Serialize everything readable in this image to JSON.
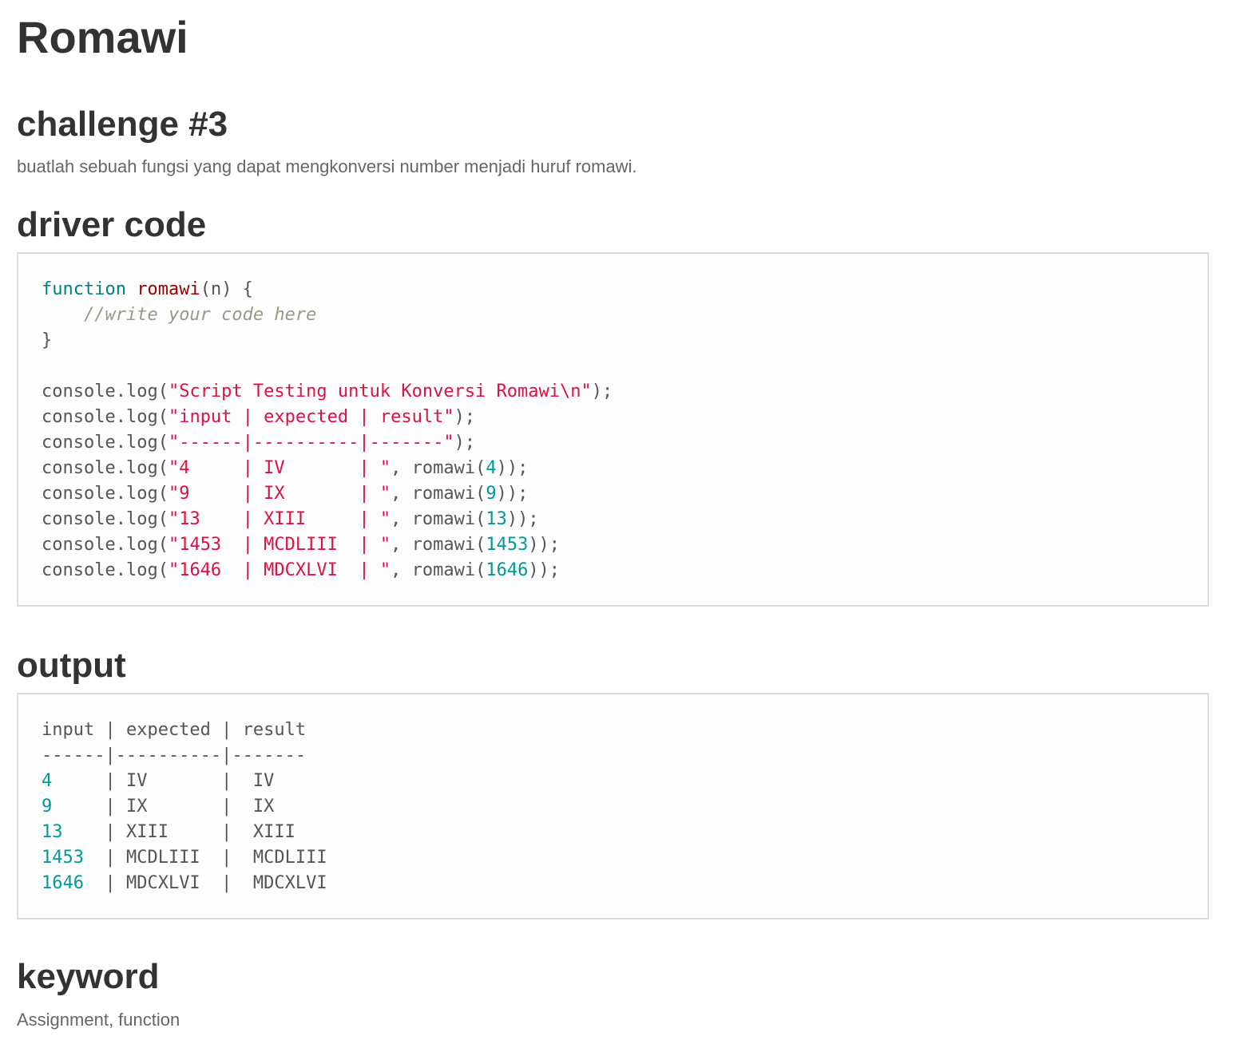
{
  "title": "Romawi",
  "challenge": {
    "heading": "challenge #3",
    "description": "buatlah sebuah fungsi yang dapat mengkonversi number menjadi huruf romawi."
  },
  "driver": {
    "heading": "driver code",
    "lines": [
      [
        {
          "t": "function",
          "c": "kw"
        },
        {
          "t": " ",
          "c": "plain"
        },
        {
          "t": "romawi",
          "c": "fn"
        },
        {
          "t": "(n) {",
          "c": "plain"
        }
      ],
      [
        {
          "t": "    ",
          "c": "plain"
        },
        {
          "t": "//write your code here",
          "c": "cm"
        }
      ],
      [
        {
          "t": "}",
          "c": "plain"
        }
      ],
      [],
      [
        {
          "t": "console.log(",
          "c": "plain"
        },
        {
          "t": "\"Script Testing untuk Konversi Romawi\\n\"",
          "c": "str"
        },
        {
          "t": ");",
          "c": "plain"
        }
      ],
      [
        {
          "t": "console.log(",
          "c": "plain"
        },
        {
          "t": "\"input | expected | result\"",
          "c": "str"
        },
        {
          "t": ");",
          "c": "plain"
        }
      ],
      [
        {
          "t": "console.log(",
          "c": "plain"
        },
        {
          "t": "\"------|----------|-------\"",
          "c": "str"
        },
        {
          "t": ");",
          "c": "plain"
        }
      ],
      [
        {
          "t": "console.log(",
          "c": "plain"
        },
        {
          "t": "\"4     | IV       | \"",
          "c": "str"
        },
        {
          "t": ", romawi(",
          "c": "plain"
        },
        {
          "t": "4",
          "c": "num"
        },
        {
          "t": "));",
          "c": "plain"
        }
      ],
      [
        {
          "t": "console.log(",
          "c": "plain"
        },
        {
          "t": "\"9     | IX       | \"",
          "c": "str"
        },
        {
          "t": ", romawi(",
          "c": "plain"
        },
        {
          "t": "9",
          "c": "num"
        },
        {
          "t": "));",
          "c": "plain"
        }
      ],
      [
        {
          "t": "console.log(",
          "c": "plain"
        },
        {
          "t": "\"13    | XIII     | \"",
          "c": "str"
        },
        {
          "t": ", romawi(",
          "c": "plain"
        },
        {
          "t": "13",
          "c": "num"
        },
        {
          "t": "));",
          "c": "plain"
        }
      ],
      [
        {
          "t": "console.log(",
          "c": "plain"
        },
        {
          "t": "\"1453  | MCDLIII  | \"",
          "c": "str"
        },
        {
          "t": ", romawi(",
          "c": "plain"
        },
        {
          "t": "1453",
          "c": "num"
        },
        {
          "t": "));",
          "c": "plain"
        }
      ],
      [
        {
          "t": "console.log(",
          "c": "plain"
        },
        {
          "t": "\"1646  | MDCXLVI  | \"",
          "c": "str"
        },
        {
          "t": ", romawi(",
          "c": "plain"
        },
        {
          "t": "1646",
          "c": "num"
        },
        {
          "t": "));",
          "c": "plain"
        }
      ]
    ]
  },
  "output": {
    "heading": "output",
    "lines": [
      [
        {
          "t": "input | expected | result",
          "c": "plain"
        }
      ],
      [
        {
          "t": "------|----------|-------",
          "c": "plain"
        }
      ],
      [
        {
          "t": "4",
          "c": "num"
        },
        {
          "t": "     | IV       |  IV",
          "c": "plain"
        }
      ],
      [
        {
          "t": "9",
          "c": "num"
        },
        {
          "t": "     | IX       |  IX",
          "c": "plain"
        }
      ],
      [
        {
          "t": "13",
          "c": "num"
        },
        {
          "t": "    | XIII     |  XIII",
          "c": "plain"
        }
      ],
      [
        {
          "t": "1453",
          "c": "num"
        },
        {
          "t": "  | MCDLIII  |  MCDLIII",
          "c": "plain"
        }
      ],
      [
        {
          "t": "1646",
          "c": "num"
        },
        {
          "t": "  | MDCXLVI  |  MDCXLVI",
          "c": "plain"
        }
      ]
    ]
  },
  "keyword": {
    "heading": "keyword",
    "text": "Assignment, function"
  }
}
